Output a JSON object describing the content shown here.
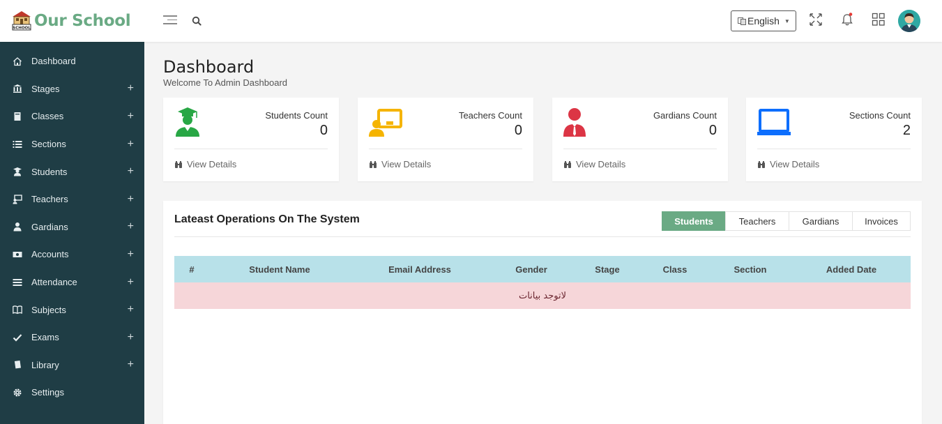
{
  "app": {
    "name": "Our School",
    "badge_text": "SCHOOL"
  },
  "header": {
    "language": "English",
    "icons": [
      "menu-icon",
      "search-icon",
      "fullscreen-icon",
      "bell-icon",
      "apps-grid-icon",
      "avatar"
    ],
    "accent_color": "#6aaa84"
  },
  "sidebar": {
    "background": "#1f3d45",
    "items": [
      {
        "label": "Dashboard",
        "icon": "home-icon",
        "expandable": false
      },
      {
        "label": "Stages",
        "icon": "building-icon",
        "expandable": true
      },
      {
        "label": "Classes",
        "icon": "book-icon",
        "expandable": true
      },
      {
        "label": "Sections",
        "icon": "list-icon",
        "expandable": true
      },
      {
        "label": "Students",
        "icon": "student-icon",
        "expandable": true
      },
      {
        "label": "Teachers",
        "icon": "teacher-icon",
        "expandable": true
      },
      {
        "label": "Gardians",
        "icon": "user-icon",
        "expandable": true
      },
      {
        "label": "Accounts",
        "icon": "money-icon",
        "expandable": true
      },
      {
        "label": "Attendance",
        "icon": "list-icon",
        "expandable": true
      },
      {
        "label": "Subjects",
        "icon": "open-book-icon",
        "expandable": true
      },
      {
        "label": "Exams",
        "icon": "check-icon",
        "expandable": true
      },
      {
        "label": "Library",
        "icon": "book-icon",
        "expandable": true
      },
      {
        "label": "Settings",
        "icon": "gear-icon",
        "expandable": false
      }
    ],
    "plus": "+"
  },
  "page": {
    "title": "Dashboard",
    "subtitle": "Welcome To Admin Dashboard"
  },
  "cards": [
    {
      "label": "Students Count",
      "count": "0",
      "details": "View Details",
      "icon": "graduate-icon",
      "color": "#28a745"
    },
    {
      "label": "Teachers Count",
      "count": "0",
      "details": "View Details",
      "icon": "teacher-board-icon",
      "color": "#f5b400"
    },
    {
      "label": "Gardians Count",
      "count": "0",
      "details": "View Details",
      "icon": "person-tie-icon",
      "color": "#dc3545"
    },
    {
      "label": "Sections Count",
      "count": "2",
      "details": "View Details",
      "icon": "laptop-icon",
      "color": "#0d6efd"
    }
  ],
  "operations": {
    "title": "Lateast Operations On The System",
    "tabs": [
      "Students",
      "Teachers",
      "Gardians",
      "Invoices"
    ],
    "active_tab": "Students",
    "columns": [
      "#",
      "Student Name",
      "Email Address",
      "Gender",
      "Stage",
      "Class",
      "Section",
      "Added Date"
    ],
    "empty_message": "لاتوجد بيانات"
  }
}
